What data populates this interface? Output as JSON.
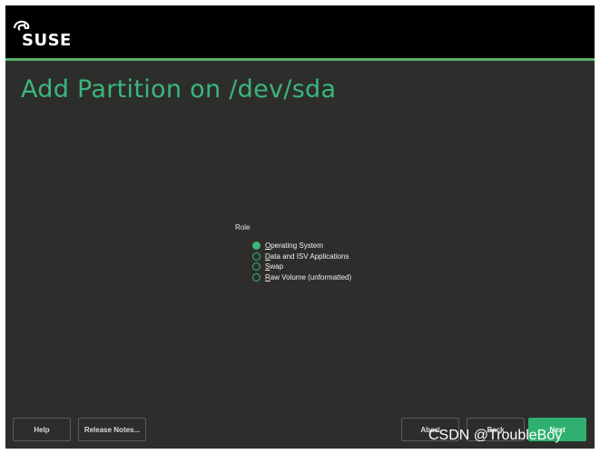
{
  "header": {
    "logo_text": "SUSE",
    "title": "Add Partition on /dev/sda"
  },
  "role": {
    "label": "Role",
    "options": [
      {
        "label_first": "O",
        "label_rest": "perating System",
        "checked": true
      },
      {
        "label_first": "D",
        "label_rest": "ata and ISV Applications",
        "checked": false
      },
      {
        "label_first": "S",
        "label_rest": "wap",
        "checked": false
      },
      {
        "label_first": "R",
        "label_rest": "aw Volume (unformatted)",
        "checked": false
      }
    ]
  },
  "buttons": {
    "help": "Help",
    "release_notes": "Release Notes...",
    "abort": "Abort",
    "back": "Back",
    "next": "Next"
  },
  "watermark": "CSDN @TroubleBoy",
  "colors": {
    "background": "#2d2e2b",
    "header": "#000000",
    "accent": "#3bb67c",
    "next_button": "#2fb070"
  }
}
